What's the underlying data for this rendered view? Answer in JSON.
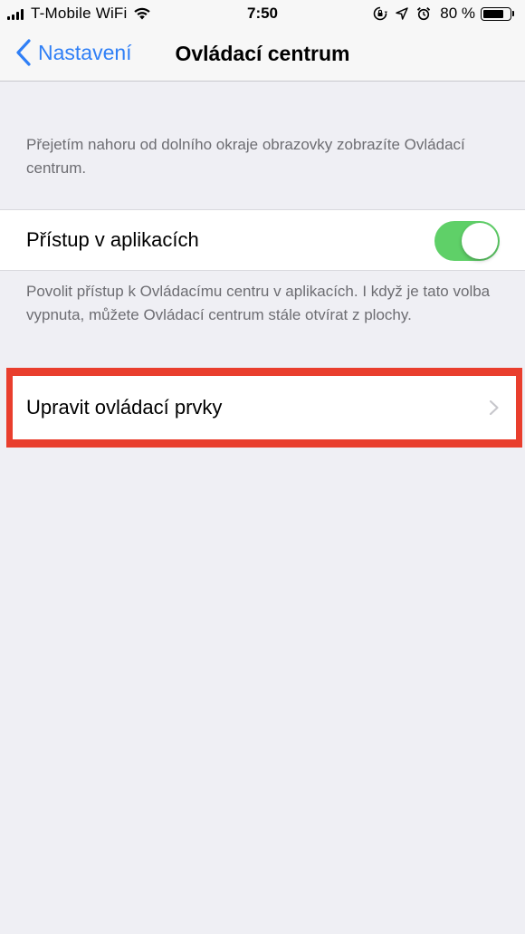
{
  "status_bar": {
    "carrier": "T-Mobile WiFi",
    "time": "7:50",
    "battery_percent": "80 %",
    "battery_level": 0.8,
    "icons": [
      "signal-icon",
      "wifi-icon",
      "rotation-lock-icon",
      "location-icon",
      "alarm-icon",
      "battery-icon"
    ]
  },
  "nav": {
    "back_label": "Nastavení",
    "title": "Ovládací centrum"
  },
  "intro_footer": "Přejetím nahoru od dolního okraje obrazovky zobrazíte Ovládací centrum.",
  "access_cell": {
    "label": "Přístup v aplikacích",
    "toggle_on": true
  },
  "access_footer": "Povolit přístup k Ovládacímu centru v aplikacích. I když je tato volba vypnuta, můžete Ovládací centrum stále otvírat z plochy.",
  "edit_cell": {
    "label": "Upravit ovládací prvky"
  },
  "colors": {
    "accent": "#2f7ff6",
    "toggle_on": "#5fd068",
    "highlight": "#e93e2d",
    "background": "#efeff4"
  }
}
